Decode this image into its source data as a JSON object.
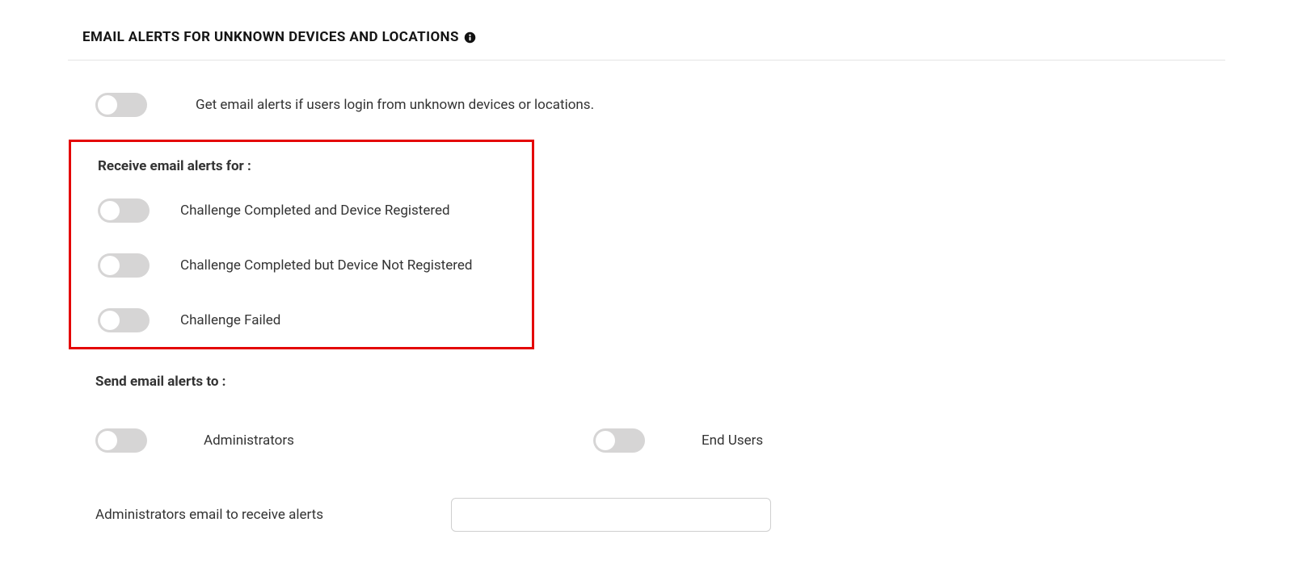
{
  "header": {
    "title": "EMAIL ALERTS FOR UNKNOWN DEVICES AND LOCATIONS"
  },
  "main_toggle": {
    "label": "Get email alerts if users login from unknown devices or locations."
  },
  "receive_alerts": {
    "heading": "Receive email alerts for :",
    "items": [
      {
        "label": "Challenge Completed and Device Registered"
      },
      {
        "label": "Challenge Completed but Device Not Registered"
      },
      {
        "label": "Challenge Failed"
      }
    ]
  },
  "send_to": {
    "heading": "Send email alerts to :",
    "admins_label": "Administrators",
    "endusers_label": "End Users"
  },
  "admin_email": {
    "label": "Administrators email to receive alerts",
    "value": ""
  }
}
